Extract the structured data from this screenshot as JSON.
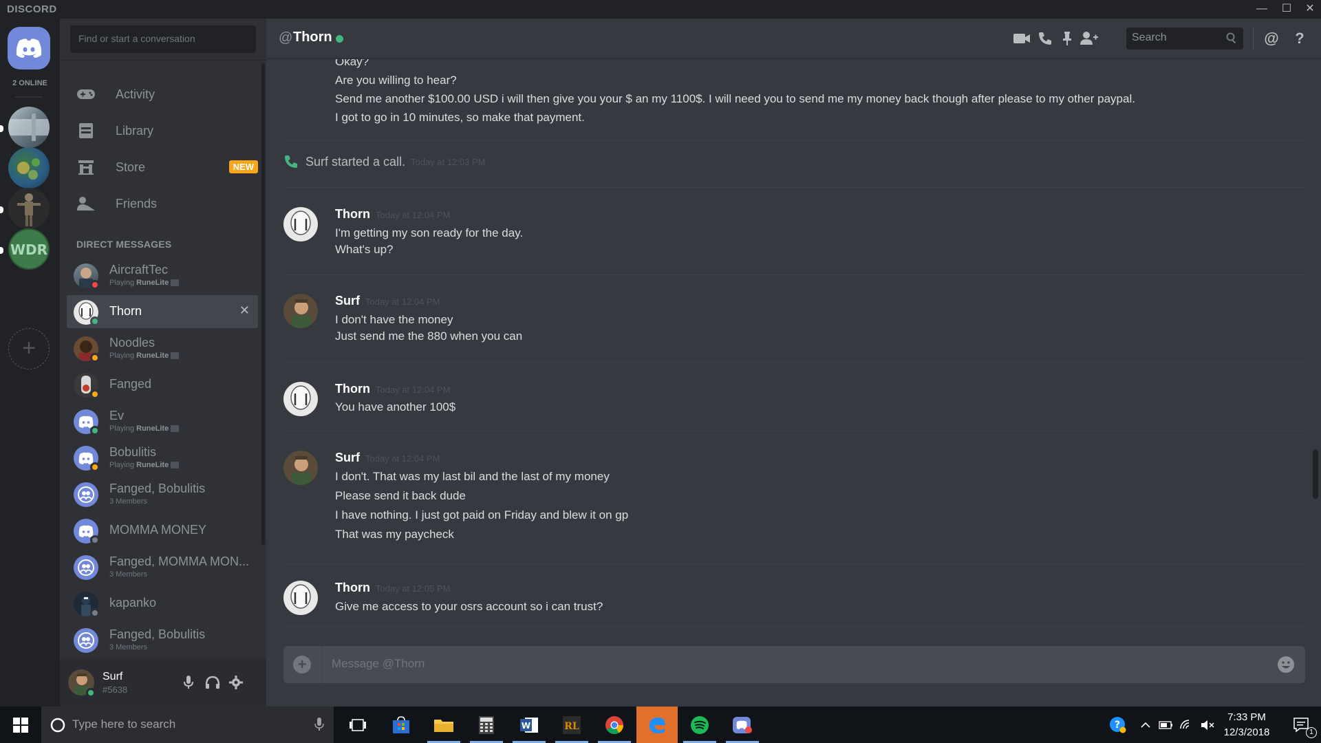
{
  "app": {
    "brand": "DISCORD"
  },
  "guilds": {
    "online_count": "2 ONLINE",
    "add_label": "+"
  },
  "sidebar": {
    "search_placeholder": "Find or start a conversation",
    "nav": [
      {
        "label": "Activity",
        "icon": "gamepad-icon"
      },
      {
        "label": "Library",
        "icon": "library-icon"
      },
      {
        "label": "Store",
        "icon": "store-icon",
        "badge": "NEW"
      },
      {
        "label": "Friends",
        "icon": "friends-icon"
      }
    ],
    "dm_header": "DIRECT MESSAGES",
    "dms": [
      {
        "name": "AircraftTec",
        "sub_prefix": "Playing",
        "sub_game": "RuneLite",
        "status": "dnd"
      },
      {
        "name": "Thorn",
        "status": "online",
        "active": true,
        "close": "✕"
      },
      {
        "name": "Noodles",
        "sub_prefix": "Playing",
        "sub_game": "RuneLite",
        "status": "idle"
      },
      {
        "name": "Fanged",
        "status": "idle"
      },
      {
        "name": "Ev",
        "sub_prefix": "Playing",
        "sub_game": "RuneLite",
        "status": "online"
      },
      {
        "name": "Bobulitis",
        "sub_prefix": "Playing",
        "sub_game": "RuneLite",
        "status": "idle"
      },
      {
        "name": "Fanged, Bobulitis",
        "sub": "3 Members"
      },
      {
        "name": "MOMMA MONEY",
        "status": "offline"
      },
      {
        "name": "Fanged, MOMMA MON...",
        "sub": "3 Members"
      },
      {
        "name": "kapanko",
        "status": "offline"
      },
      {
        "name": "Fanged, Bobulitis",
        "sub": "3 Members"
      }
    ]
  },
  "user": {
    "name": "Surf",
    "tag": "#5638"
  },
  "chat": {
    "at": "@",
    "channel_name": "Thorn",
    "search_placeholder": "Search",
    "composer_placeholder": "Message @Thorn",
    "top_lines": [
      "Okay?",
      "Are you willing to hear?",
      "Send me another $100.00 USD i will then give you your $ an my 1100$. I will need you to send me my money back though after please to my other paypal.",
      "I got to go in 10 minutes, so make that payment."
    ],
    "system": {
      "text": "Surf started a call.",
      "time": "Today at 12:03 PM"
    },
    "messages": [
      {
        "author": "Thorn",
        "time": "Today at 12:04 PM",
        "lines": [
          "I'm getting my son ready for the day.",
          "What's up?"
        ]
      },
      {
        "author": "Surf",
        "time": "Today at 12:04 PM",
        "lines": [
          "I don't have the money",
          "Just send me the 880 when you can"
        ]
      },
      {
        "author": "Thorn",
        "time": "Today at 12:04 PM",
        "lines": [
          "You have another 100$"
        ]
      },
      {
        "author": "Surf",
        "time": "Today at 12:04 PM",
        "lines": [
          "I don't. That was my last bil and the last of my money",
          "Please send it back dude",
          "I have nothing. I just got paid on Friday and blew it on gp",
          "That was my paycheck"
        ]
      },
      {
        "author": "Thorn",
        "time": "Today at 12:05 PM",
        "lines": [
          "Give me access to your osrs account so i can trust?"
        ]
      }
    ]
  },
  "taskbar": {
    "search_placeholder": "Type here to search",
    "time": "7:33 PM",
    "date": "12/3/2018",
    "notif_count": "1"
  },
  "colors": {
    "online": "#43b581",
    "idle": "#faa61a",
    "dnd": "#f04747",
    "offline": "#747f8d",
    "blurple": "#7289da"
  }
}
